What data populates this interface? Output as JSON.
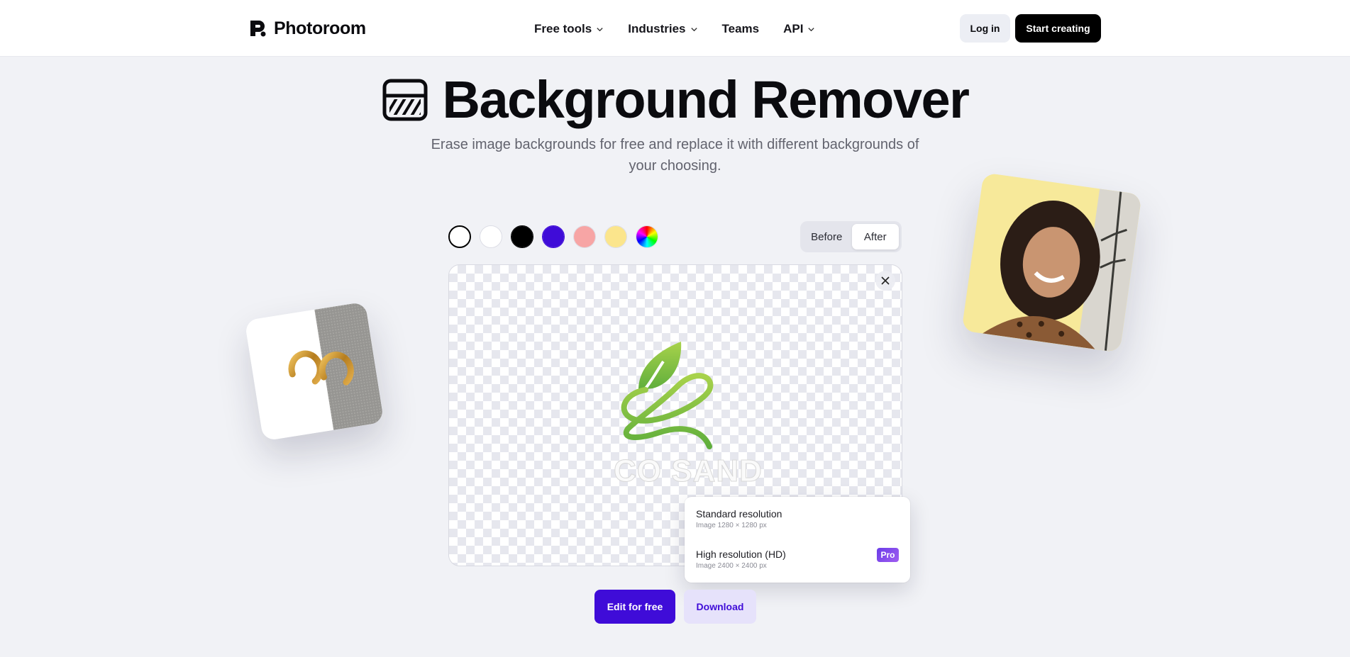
{
  "header": {
    "brand": "Photoroom",
    "nav": [
      {
        "label": "Free tools",
        "has_dropdown": true
      },
      {
        "label": "Industries",
        "has_dropdown": true
      },
      {
        "label": "Teams",
        "has_dropdown": false
      },
      {
        "label": "API",
        "has_dropdown": true
      }
    ],
    "login_label": "Log in",
    "start_label": "Start creating"
  },
  "hero": {
    "title": "Background Remover",
    "subtitle": "Erase image backgrounds for free and replace it with different backgrounds of your choosing."
  },
  "editor": {
    "swatches": [
      {
        "name": "transparent",
        "color": "#ffffff",
        "selected": true
      },
      {
        "name": "white",
        "color": "#ffffff",
        "selected": false
      },
      {
        "name": "black",
        "color": "#000000",
        "selected": false
      },
      {
        "name": "indigo",
        "color": "#3f0cd8",
        "selected": false
      },
      {
        "name": "pink",
        "color": "#f7a5a5",
        "selected": false
      },
      {
        "name": "yellow",
        "color": "#fbe58c",
        "selected": false
      },
      {
        "name": "custom",
        "color": "rainbow",
        "selected": false
      }
    ],
    "toggle": {
      "before": "Before",
      "after": "After",
      "active": "After"
    },
    "subject_text": "CO SAND",
    "close_icon": "close-icon"
  },
  "resolution_menu": {
    "standard_title": "Standard resolution",
    "standard_sub": "Image 1280 × 1280 px",
    "hd_title": "High resolution (HD)",
    "hd_sub": "Image 2400 × 2400 px",
    "pro_badge": "Pro"
  },
  "actions": {
    "edit_label": "Edit for free",
    "download_label": "Download"
  },
  "colors": {
    "accent": "#3f0cd8",
    "page_bg": "#f1f2f6"
  }
}
